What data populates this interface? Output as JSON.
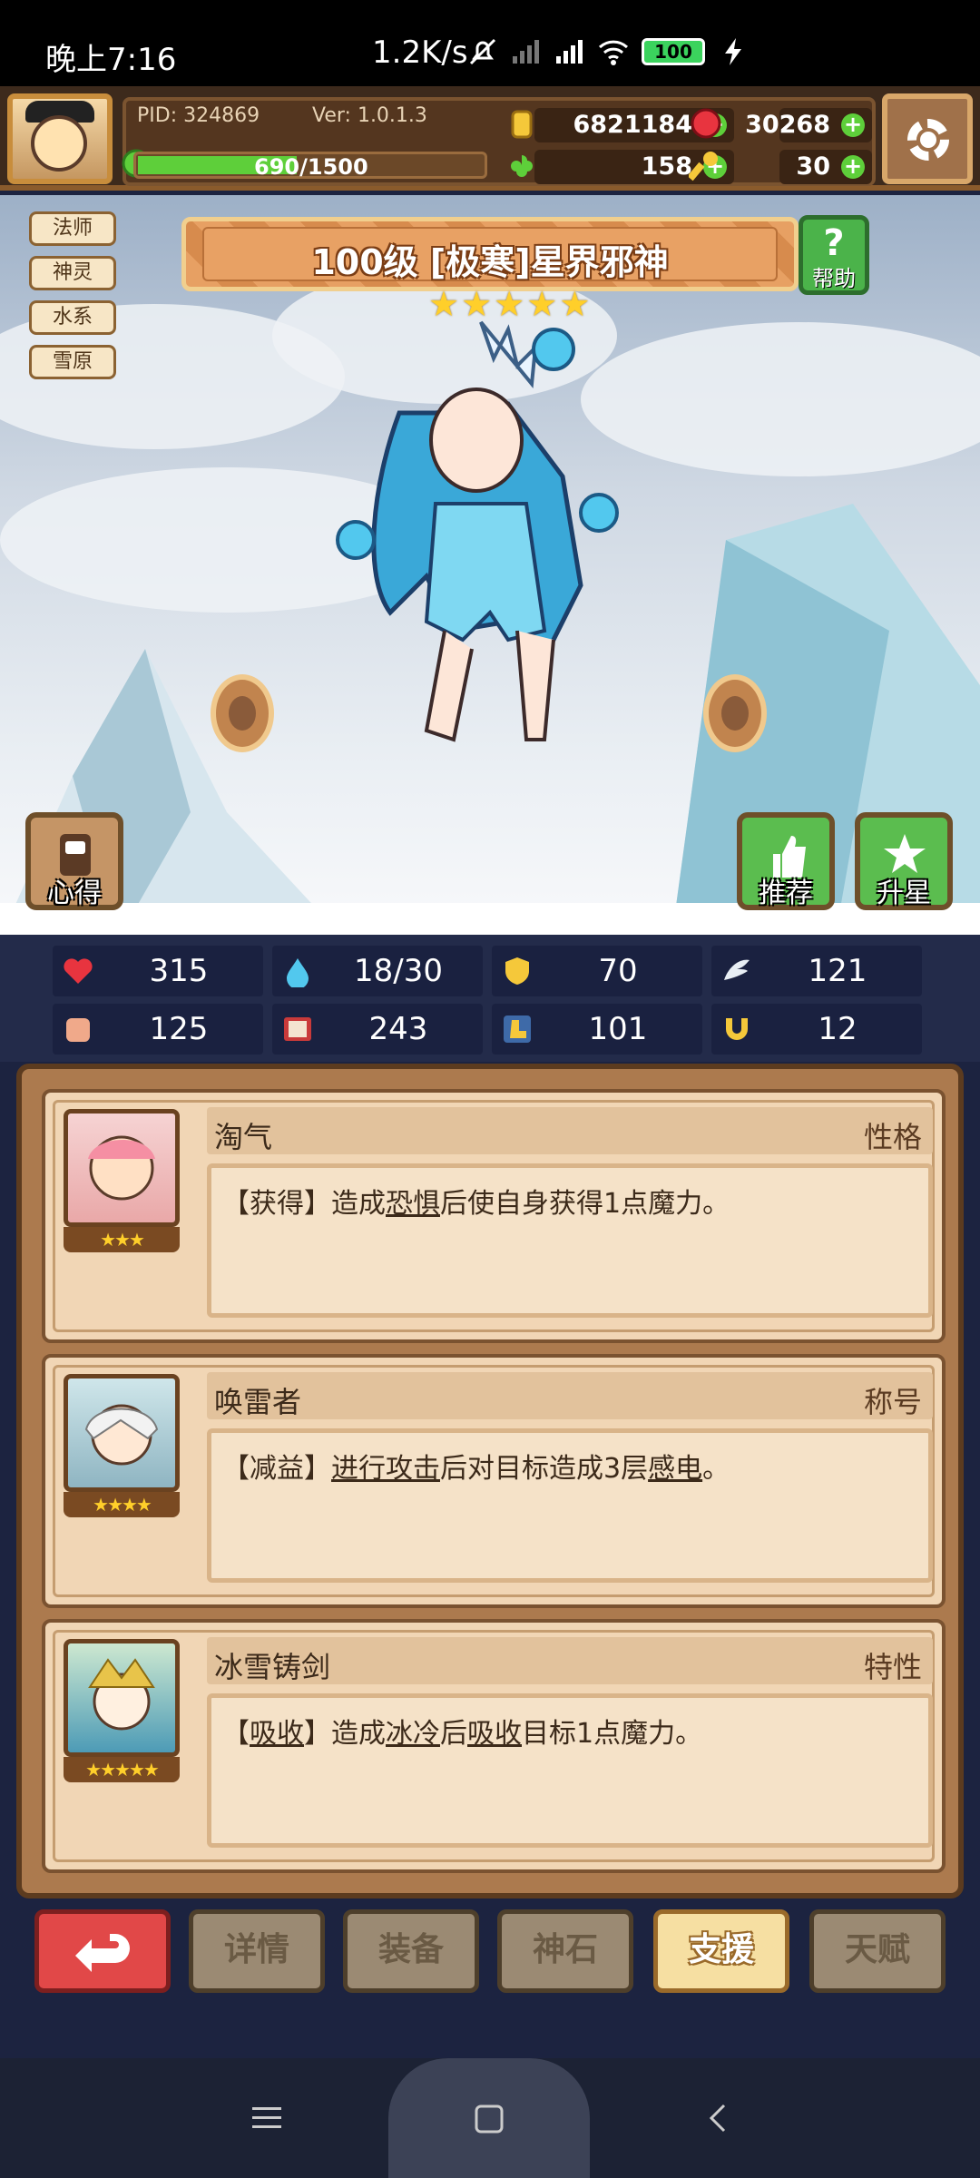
{
  "status_bar": {
    "time": "晚上7:16",
    "net_speed": "1.2K/s",
    "battery": "100",
    "icons": [
      "mute-icon",
      "signal-no-sim-icon",
      "signal-hd-icon",
      "wifi-icon",
      "battery-icon",
      "charging-icon"
    ]
  },
  "header": {
    "pid": "PID: 324869",
    "version": "Ver: 1.0.1.3",
    "xp_text": "690/1500",
    "xp_progress": 0.46,
    "gold": "6821184",
    "ruby": "30268",
    "clover": "158",
    "key": "30"
  },
  "hero": {
    "tags": [
      "法师",
      "神灵",
      "水系",
      "雪原"
    ],
    "name": "100级 [极寒]星界邪神",
    "stars": 5,
    "help_label": "帮助",
    "notes_label": "心得",
    "recommend_label": "推荐",
    "star_up_label": "升星"
  },
  "stats": [
    {
      "icon": "heart-icon",
      "value": "315"
    },
    {
      "icon": "water-drop-icon",
      "value": "18/30"
    },
    {
      "icon": "shield-icon",
      "value": "70"
    },
    {
      "icon": "wing-icon",
      "value": "121"
    },
    {
      "icon": "fist-icon",
      "value": "125"
    },
    {
      "icon": "book-icon",
      "value": "243"
    },
    {
      "icon": "boot-icon",
      "value": "101"
    },
    {
      "icon": "horseshoe-icon",
      "value": "12"
    }
  ],
  "cards": [
    {
      "name": "淘气",
      "type": "性格",
      "stars": "★★★",
      "desc": [
        {
          "t": "【获得】造成",
          "u": false
        },
        {
          "t": "恐惧",
          "u": true
        },
        {
          "t": "后使自身获得1点魔力。",
          "u": false
        }
      ]
    },
    {
      "name": "唤雷者",
      "type": "称号",
      "stars": "★★★★",
      "desc": [
        {
          "t": "【减益】",
          "u": false
        },
        {
          "t": "进行攻击",
          "u": true
        },
        {
          "t": "后对目标造成3层",
          "u": false
        },
        {
          "t": "感电",
          "u": true
        },
        {
          "t": "。",
          "u": false
        }
      ]
    },
    {
      "name": "冰雪铸剑",
      "type": "特性",
      "stars": "★★★★★",
      "desc": [
        {
          "t": "【",
          "u": false
        },
        {
          "t": "吸收",
          "u": true
        },
        {
          "t": "】造成",
          "u": false
        },
        {
          "t": "冰冷",
          "u": true
        },
        {
          "t": "后",
          "u": false
        },
        {
          "t": "吸收",
          "u": true
        },
        {
          "t": "目标1点魔力。",
          "u": false
        }
      ]
    }
  ],
  "bottom_tabs": [
    "详情",
    "装备",
    "神石",
    "支援",
    "天赋"
  ],
  "active_tab": "支援",
  "nav": [
    "menu-icon",
    "home-icon",
    "back-icon"
  ]
}
